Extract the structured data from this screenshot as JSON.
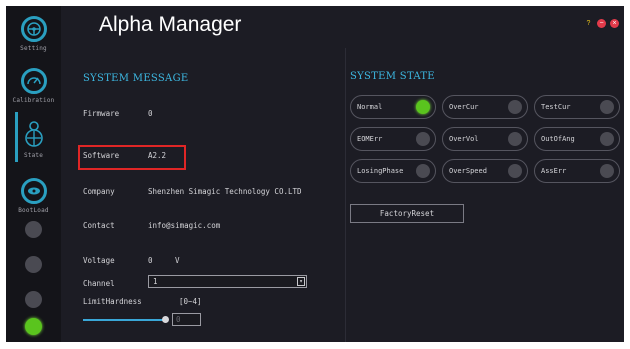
{
  "app": {
    "title": "Alpha Manager"
  },
  "window_controls": [
    {
      "label": "?",
      "color": "#e8c21a"
    },
    {
      "label": "−",
      "color": "#e23a4a"
    },
    {
      "label": "×",
      "color": "#e23a4a"
    }
  ],
  "sidebar": {
    "items": [
      {
        "label": "Setting",
        "icon": "steering-wheel-icon"
      },
      {
        "label": "Calibration",
        "icon": "gauge-icon"
      },
      {
        "label": "State",
        "icon": "driver-icon"
      },
      {
        "label": "BootLoad",
        "icon": "boot-icon"
      }
    ],
    "active": "State"
  },
  "system_message": {
    "title": "SYSTEM MESSAGE",
    "firmware_label": "Firmware",
    "firmware_value": "0",
    "software_label": "Software",
    "software_value": "A2.2",
    "company_label": "Company",
    "company_value": "Shenzhen Simagic Technology CO.LTD",
    "contact_label": "Contact",
    "contact_value": "info@simagic.com",
    "voltage_label": "Voltage",
    "voltage_value": "0",
    "voltage_unit": "V",
    "channel_label": "Channel",
    "channel_value": "1",
    "limit_label": "LimitHardness",
    "limit_range": "[0~4]",
    "limit_value": "0"
  },
  "system_state": {
    "title": "SYSTEM STATE",
    "cells": [
      {
        "label": "Normal",
        "on": true
      },
      {
        "label": "OverCur",
        "on": false
      },
      {
        "label": "TestCur",
        "on": false
      },
      {
        "label": "EOMErr",
        "on": false
      },
      {
        "label": "OverVol",
        "on": false
      },
      {
        "label": "OutOfAng",
        "on": false
      },
      {
        "label": "LosingPhase",
        "on": false
      },
      {
        "label": "OverSpeed",
        "on": false
      },
      {
        "label": "AssErr",
        "on": false
      }
    ],
    "factory_reset_label": "FactoryReset"
  },
  "colors": {
    "accent": "#3db9e3",
    "led_on": "#5ac41e",
    "highlight": "#e02626"
  }
}
